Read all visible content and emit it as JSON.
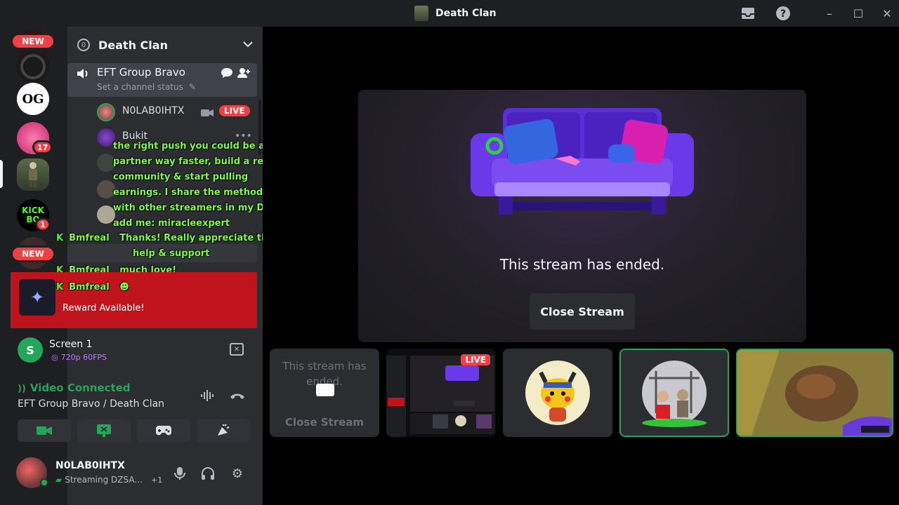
{
  "window": {
    "title": "Death Clan",
    "controls": {
      "minimize": "–",
      "maximize": "☐",
      "close": "✕"
    }
  },
  "rail": {
    "new_badge_top": "NEW",
    "new_badge_bottom": "NEW",
    "servers": [
      {
        "label": "OG",
        "badge": ""
      },
      {
        "label": "",
        "badge": "17"
      },
      {
        "label": "",
        "badge": ""
      },
      {
        "label": "KICK BO",
        "badge": "1"
      }
    ]
  },
  "sidebar": {
    "guild": {
      "name": "Death Clan",
      "boost_level": "0"
    },
    "voice_channel": {
      "name": "EFT Group Bravo",
      "status_placeholder": "Set a channel status"
    },
    "members": [
      {
        "name": "N0LAB0IHTX",
        "live": "LIVE"
      },
      {
        "name": "Bukit"
      }
    ],
    "stream_overlay": {
      "message_lines": [
        "the right push you could be at",
        "partner way faster, build a real",
        "community & start pulling",
        "earnings. I share the method I use",
        "with other streamers in my Discord",
        "add me: miracleexpert"
      ],
      "chat": [
        {
          "user": "Bmfreal",
          "text": "Thanks! Really appreciate the"
        },
        {
          "user": "",
          "text": "help & support"
        },
        {
          "user": "Bmfreal",
          "text": "much love!"
        },
        {
          "user": "Bmfreal",
          "text": ""
        }
      ]
    },
    "reward": {
      "text": "Reward Available!"
    },
    "screen_share": {
      "name": "Screen 1",
      "quality": "720p 60FPS",
      "icon_letter": "S"
    },
    "rtc": {
      "title": "Video Connected",
      "channel": "EFT Group Bravo / Death Clan"
    },
    "user": {
      "name": "N0LAB0IHTX",
      "status": "Streaming DZSA...",
      "extra": "+1"
    }
  },
  "stage": {
    "main": {
      "ended_text": "This stream has ended.",
      "close_button": "Close Stream"
    },
    "tiles": [
      {
        "ended_text": "This stream has ended.",
        "close_button": "Close Stream"
      },
      {
        "live": "LIVE"
      },
      {},
      {},
      {}
    ]
  },
  "colors": {
    "accent_green": "#23a55a",
    "live_red": "#f23f43",
    "reward_red": "#c0141c",
    "overlay_green": "#7cfc3d"
  }
}
